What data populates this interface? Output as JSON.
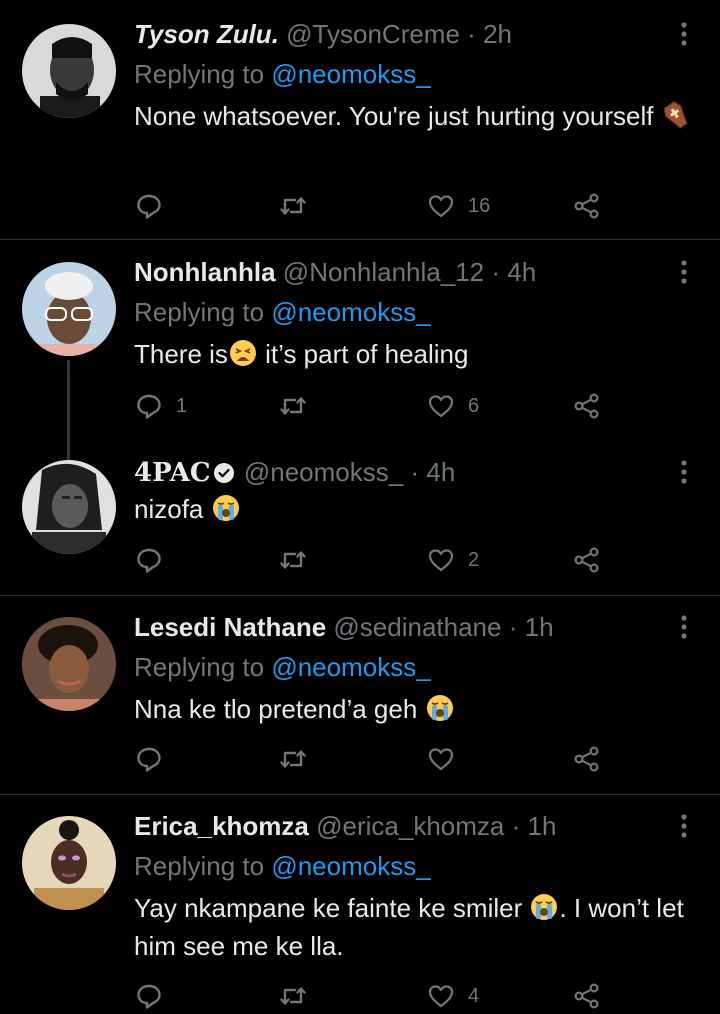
{
  "tweets": [
    {
      "name": "Tyson Zulu.",
      "handle": "@TysonCreme",
      "time": "2h",
      "replying_label": "Replying to",
      "replying_to": "@neomokss_",
      "text": "None whatsoever. You're just hurting yourself",
      "text_emoji": "coffin-emoji",
      "reply_count": "",
      "retweet_count": "",
      "like_count": "16"
    },
    {
      "name": "Nonhlanhla",
      "handle": "@Nonhlanhla_12",
      "time": "4h",
      "replying_label": "Replying to",
      "replying_to": "@neomokss_",
      "text_before": "There is",
      "text_emoji": "weary-face-emoji",
      "text_after": " it’s part of healing",
      "reply_count": "1",
      "retweet_count": "",
      "like_count": "6"
    },
    {
      "name": "4PAC",
      "verified": true,
      "handle": "@neomokss_",
      "time": "4h",
      "text": "nizofa ",
      "text_emoji": "loudly-crying-face-emoji",
      "reply_count": "",
      "retweet_count": "",
      "like_count": "2"
    },
    {
      "name": "Lesedi Nathane",
      "handle": "@sedinathane",
      "time": "1h",
      "replying_label": "Replying to",
      "replying_to": "@neomokss_",
      "text": "Nna ke tlo pretend’a geh ",
      "text_emoji": "loudly-crying-face-emoji",
      "reply_count": "",
      "retweet_count": "",
      "like_count": ""
    },
    {
      "name": "Erica_khomza",
      "handle": "@erica_khomza",
      "time": "1h",
      "replying_label": "Replying to",
      "replying_to": "@neomokss_",
      "text_before": "Yay nkampane ke fainte ke smiler ",
      "text_emoji": "loudly-crying-face-emoji",
      "text_after": ". I won’t let him see me ke lla.",
      "reply_count": "",
      "retweet_count": "",
      "like_count": "4"
    }
  ],
  "separator": "·",
  "colors": {
    "background": "#000000",
    "text": "#e7e9ea",
    "secondary": "#71767b",
    "mention": "#1d9bf0",
    "divider": "#2f3336"
  }
}
